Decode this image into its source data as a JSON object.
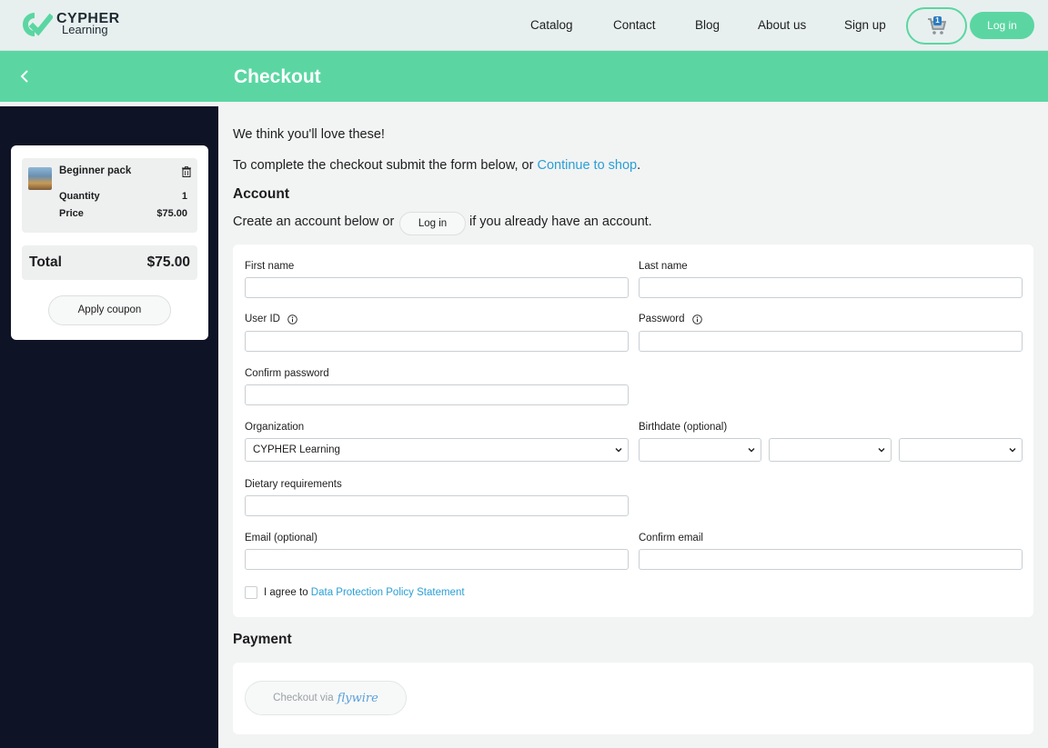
{
  "header": {
    "logo_line1": "CYPHER",
    "logo_line2": "Learning",
    "nav": [
      "Catalog",
      "Contact",
      "Blog",
      "About us",
      "Sign up"
    ],
    "cart_count": "1",
    "login": "Log in"
  },
  "banner": {
    "title": "Checkout"
  },
  "cart": {
    "item_name": "Beginner pack",
    "quantity_label": "Quantity",
    "quantity_value": "1",
    "price_label": "Price",
    "price_value": "$75.00",
    "total_label": "Total",
    "total_value": "$75.00",
    "coupon_button": "Apply coupon"
  },
  "main": {
    "intro": "We think you'll love these!",
    "instruction_prefix": "To complete the checkout submit the form below, or ",
    "continue_link": "Continue to shop",
    "instruction_suffix": ".",
    "account_heading": "Account",
    "account_prefix": "Create an account below or",
    "account_login": "Log in",
    "account_suffix": "if you already have an account."
  },
  "form": {
    "first_name": {
      "label": "First name",
      "value": ""
    },
    "last_name": {
      "label": "Last name",
      "value": ""
    },
    "user_id": {
      "label": "User ID",
      "value": ""
    },
    "password": {
      "label": "Password",
      "value": ""
    },
    "confirm_password": {
      "label": "Confirm password",
      "value": ""
    },
    "organization": {
      "label": "Organization",
      "value": "CYPHER Learning"
    },
    "birthdate": {
      "label": "Birthdate (optional)",
      "day": "",
      "month": "",
      "year": ""
    },
    "dietary": {
      "label": "Dietary requirements",
      "value": ""
    },
    "email": {
      "label": "Email (optional)",
      "value": ""
    },
    "confirm_email": {
      "label": "Confirm email",
      "value": ""
    },
    "agree_prefix": "I agree to",
    "agree_link": "Data Protection Policy Statement"
  },
  "payment": {
    "heading": "Payment",
    "button_prefix": "Checkout via",
    "button_brand": "flywire"
  },
  "colors": {
    "accent": "#5bd6a2",
    "sidebar": "#0f1326",
    "link": "#2a9fd6"
  }
}
